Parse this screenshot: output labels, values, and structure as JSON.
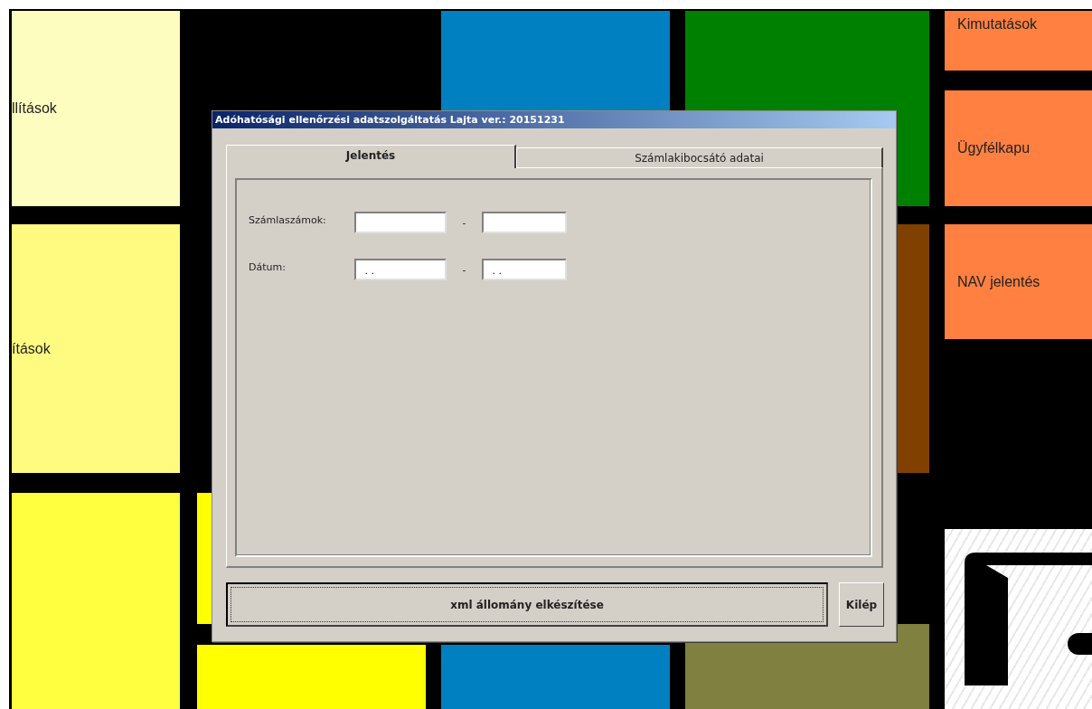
{
  "tiles": [
    {
      "kind": "text",
      "label": "llítások",
      "color": "#fefdc0"
    },
    {
      "kind": "text",
      "label": "ítások",
      "color": "#fefb80"
    },
    {
      "kind": "blank",
      "color": "#ffff40"
    },
    {
      "kind": "blank",
      "color": "#ffff00"
    },
    {
      "kind": "blank",
      "color": "#ffff00"
    },
    {
      "kind": "blank",
      "color": "#0080c0"
    },
    {
      "kind": "blank",
      "color": "#0080c0"
    },
    {
      "kind": "blank",
      "color": "#008000"
    },
    {
      "kind": "blank",
      "color": "#804000"
    },
    {
      "kind": "blank",
      "color": "#808040"
    },
    {
      "kind": "text",
      "label": "Kimutatások",
      "color": "#ff8040"
    },
    {
      "kind": "text",
      "label": "Ügyfélkapu",
      "color": "#ff8040"
    },
    {
      "kind": "text",
      "label": "NAV jelentés",
      "color": "#ff8040"
    },
    {
      "kind": "icon",
      "color": "#ffffff"
    }
  ],
  "dialog": {
    "title": "Adóhatósági ellenőrzési adatszolgáltatás Lajta ver.: 20151231",
    "tabs": [
      {
        "label": "Jelentés",
        "selected": true
      },
      {
        "label": "Számlakibocsátó adatai",
        "selected": false
      }
    ],
    "rows": [
      {
        "label": "Számlaszámok:",
        "from": "",
        "to": "",
        "separator": "-"
      },
      {
        "label": "Dátum:",
        "from": " . .",
        "to": " . .",
        "separator": "-"
      }
    ],
    "buttons": [
      {
        "label": "xml állomány elkészítése",
        "default": true
      },
      {
        "label": "Kilép",
        "default": false
      }
    ]
  }
}
